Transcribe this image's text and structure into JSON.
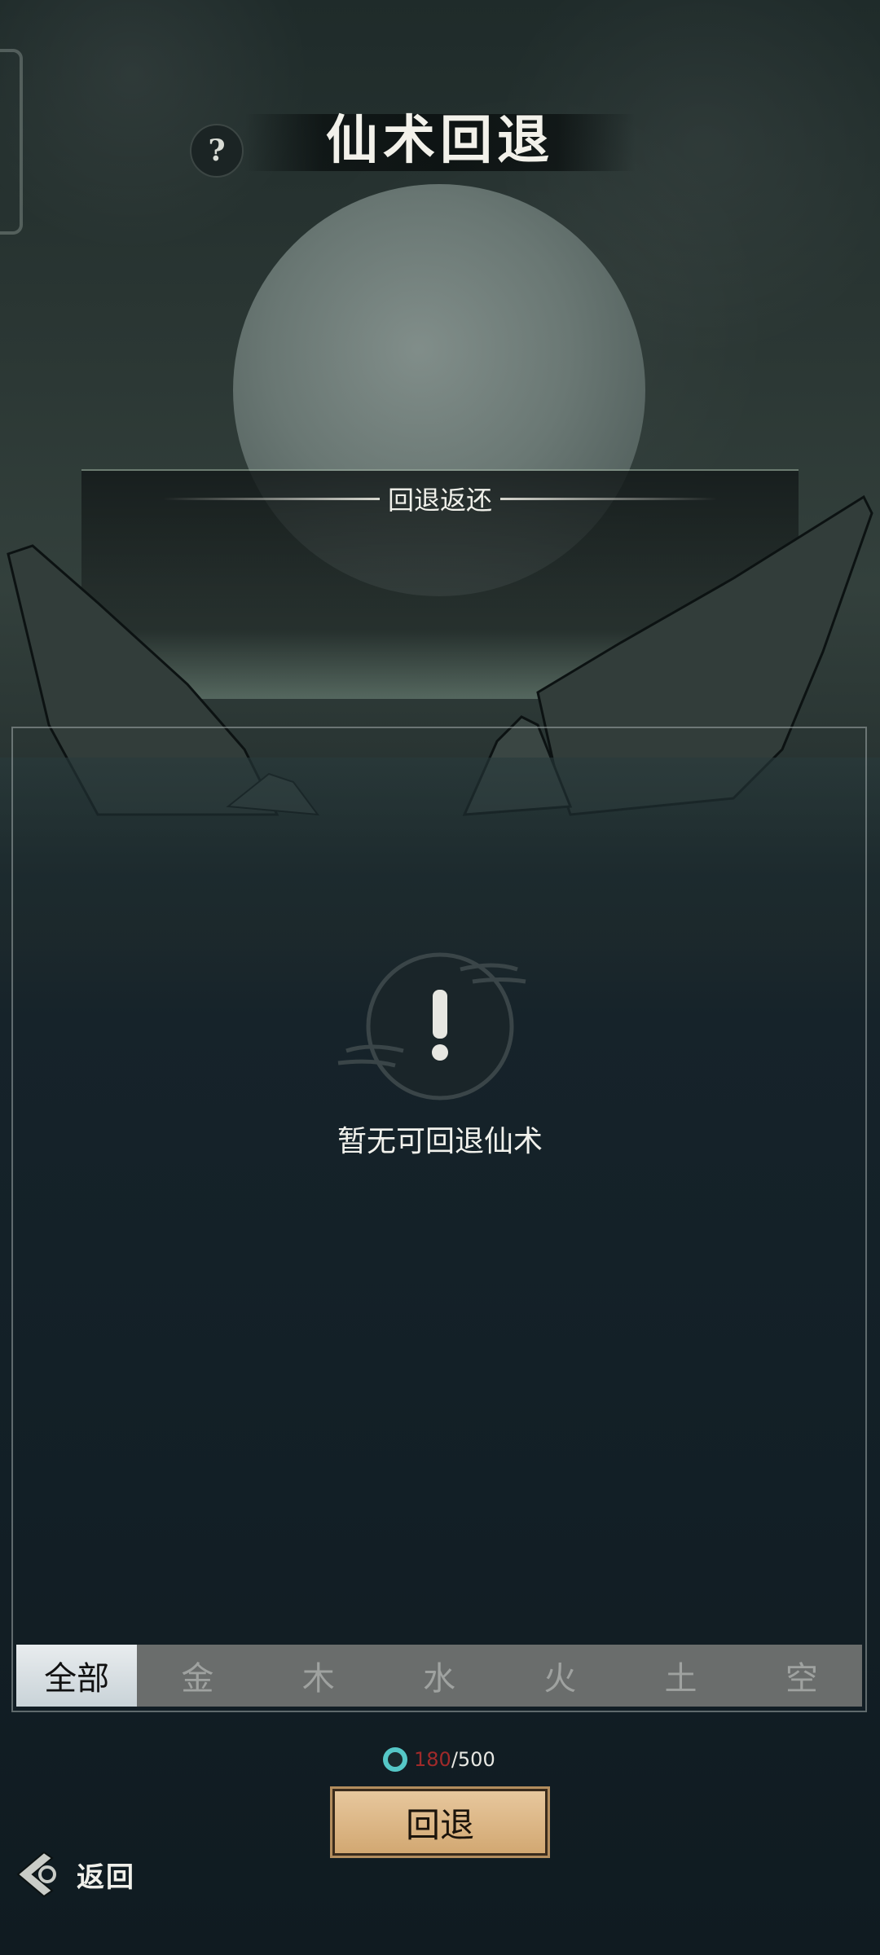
{
  "header": {
    "title": "仙术回退",
    "help_icon": "?"
  },
  "return_section": {
    "label": "回退返还"
  },
  "empty_state": {
    "icon": "exclamation-icon",
    "message": "暂无可回退仙术"
  },
  "tabs": [
    {
      "label": "全部",
      "active": true
    },
    {
      "label": "金",
      "active": false
    },
    {
      "label": "木",
      "active": false
    },
    {
      "label": "水",
      "active": false
    },
    {
      "label": "火",
      "active": false
    },
    {
      "label": "土",
      "active": false
    },
    {
      "label": "空",
      "active": false
    }
  ],
  "counter": {
    "current": "180",
    "separator": "/",
    "max": "500"
  },
  "action": {
    "label": "回退"
  },
  "back": {
    "label": "返回"
  },
  "colors": {
    "counter_current": "#a02a2a",
    "button_gold": "#d2a872",
    "tab_active": "#dfe6ea",
    "tab_inactive": "#6a6d6c"
  }
}
